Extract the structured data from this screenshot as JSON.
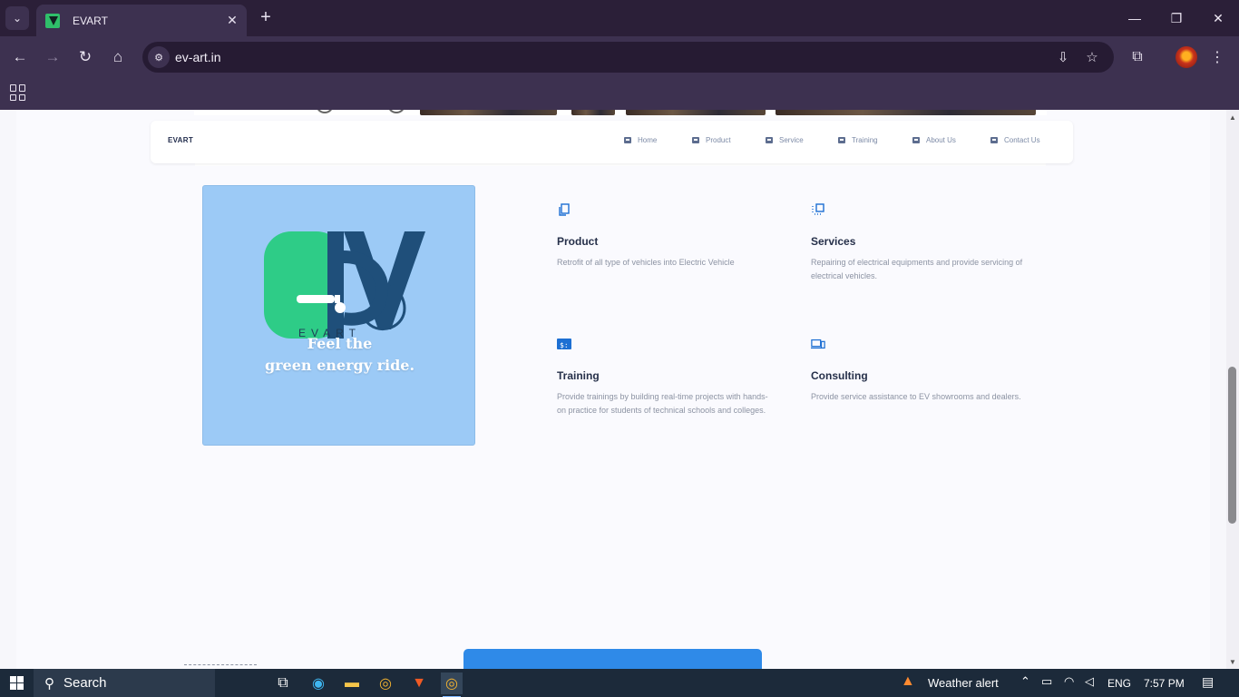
{
  "browser": {
    "tab_title": "EVART",
    "url": "ev-art.in",
    "tab_list_glyph": "⌄",
    "new_tab_glyph": "+",
    "close_glyph": "✕"
  },
  "site": {
    "brand": "EVART",
    "nav": [
      "Home",
      "Product",
      "Service",
      "Training",
      "About Us",
      "Contact Us"
    ],
    "hero": {
      "logo_letters": "EVART",
      "tagline_line1": "Feel the",
      "tagline_line2": "green energy ride."
    },
    "features": [
      {
        "icon": "copy-icon",
        "title": "Product",
        "desc": "Retrofit of all type of vehicles into Electric Vehicle"
      },
      {
        "icon": "layers-icon",
        "title": "Services",
        "desc": "Repairing of electrical equipments and provide servicing of electrical vehicles."
      },
      {
        "icon": "terminal-icon",
        "title": "Training",
        "desc": "Provide trainings by building real-time projects with hands-on practice for students of technical schools and colleges."
      },
      {
        "icon": "devices-icon",
        "title": "Consulting",
        "desc": "Provide service assistance to EV showrooms and dealers."
      }
    ]
  },
  "taskbar": {
    "search_label": "Search",
    "weather": "Weather alert",
    "language": "ENG",
    "time": "7:57 PM"
  },
  "colors": {
    "hero_bg": "#9ccaf6",
    "logo_green": "#2ecc87",
    "logo_blue": "#1f4f7a",
    "accent_blue": "#1d6fd3"
  }
}
